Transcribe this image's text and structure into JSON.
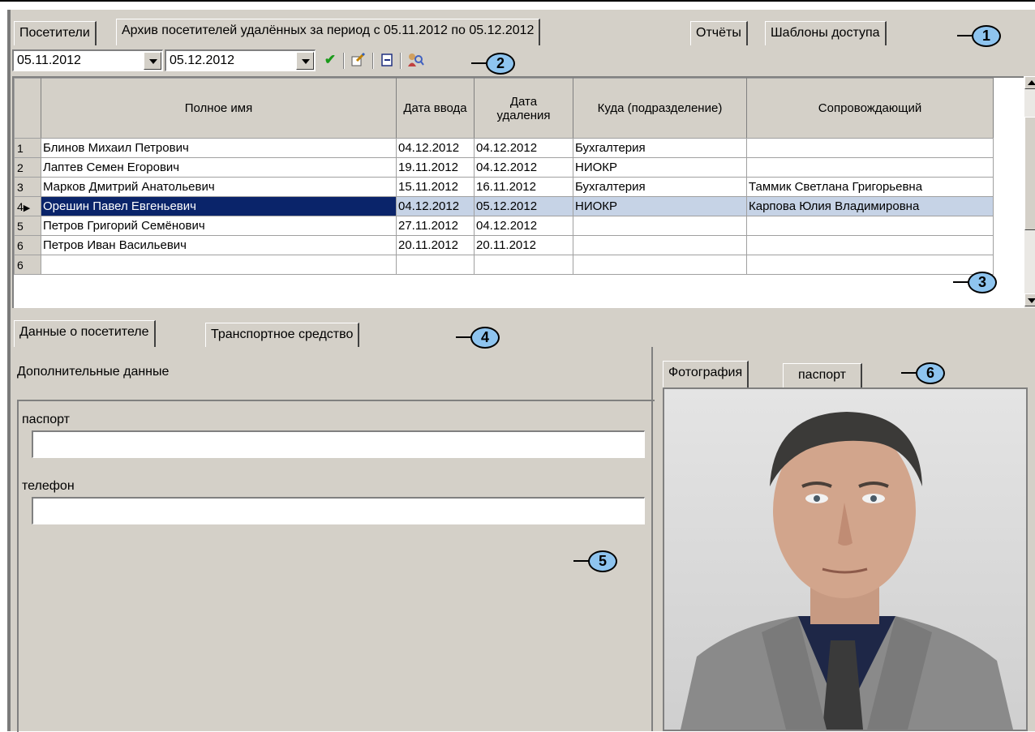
{
  "tabs_top": [
    {
      "label": "Посетители"
    },
    {
      "label": "Архив посетителей удалённых за период с 05.11.2012 по 05.12.2012"
    },
    {
      "label": "Отчёты"
    },
    {
      "label": "Шаблоны доступа"
    }
  ],
  "toolbar": {
    "date_from": "05.11.2012",
    "date_to": "05.12.2012",
    "icons": [
      "apply-check-icon",
      "edit-icon",
      "export-icon",
      "search-person-icon"
    ]
  },
  "callouts": [
    "1",
    "2",
    "3",
    "4",
    "5",
    "6"
  ],
  "grid": {
    "columns": [
      "Полное имя",
      "Дата ввода",
      "Дата удаления",
      "Куда (подразделение)",
      "Сопровождающий"
    ],
    "column_delete_line1": "Дата",
    "column_delete_line2": "удаления",
    "rows": [
      {
        "num": "1",
        "name": "Блинов Михаил Петрович",
        "entered": "04.12.2012",
        "deleted": "04.12.2012",
        "dept": "Бухгалтерия",
        "escort": ""
      },
      {
        "num": "2",
        "name": "Лаптев Семен Егорович",
        "entered": "19.11.2012",
        "deleted": "04.12.2012",
        "dept": "НИОКР",
        "escort": ""
      },
      {
        "num": "3",
        "name": "Марков Дмитрий Анатольевич",
        "entered": "15.11.2012",
        "deleted": "16.11.2012",
        "dept": "Бухгалтерия",
        "escort": "Таммик Светлана Григорьевна"
      },
      {
        "num": "4",
        "name": "Орешин Павел Евгеньевич",
        "entered": "04.12.2012",
        "deleted": "05.12.2012",
        "dept": "НИОКР",
        "escort": "Карпова Юлия Владимировна"
      },
      {
        "num": "5",
        "name": "Петров Григорий Семёнович",
        "entered": "27.11.2012",
        "deleted": "04.12.2012",
        "dept": "",
        "escort": ""
      },
      {
        "num": "6",
        "name": "Петров Иван Васильевич",
        "entered": "20.11.2012",
        "deleted": "20.11.2012",
        "dept": "",
        "escort": ""
      },
      {
        "num": "6",
        "name": "",
        "entered": "",
        "deleted": "",
        "dept": "",
        "escort": ""
      }
    ],
    "selected_row_marker": "▶"
  },
  "tabs_bottom": [
    {
      "label": "Данные о посетителе"
    },
    {
      "label": "Транспортное средство"
    }
  ],
  "details": {
    "section_title": "Дополнительные данные",
    "passport_label": "паспорт",
    "passport_value": "",
    "phone_label": "телефон",
    "phone_value": ""
  },
  "photo_tabs": [
    {
      "label": "Фотография"
    },
    {
      "label": "паспорт"
    }
  ],
  "colors": {
    "window": "#d4d0c8",
    "selection": "#0a246a",
    "selected_row": "#c6d3e6",
    "callout": "#8ec4ef"
  }
}
